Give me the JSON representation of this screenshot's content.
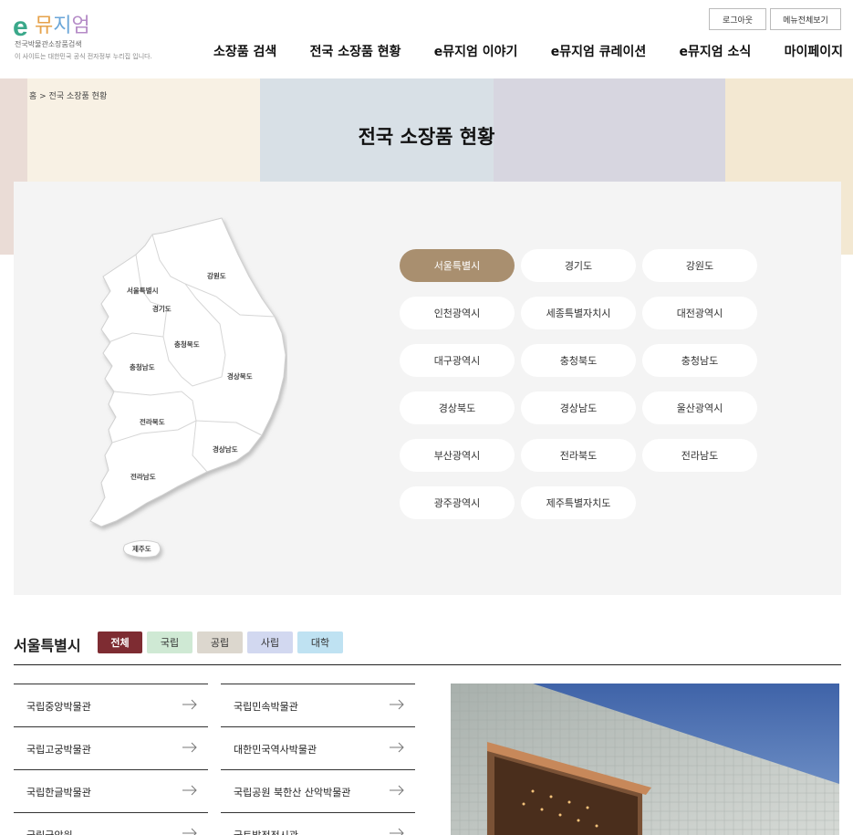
{
  "logo": {
    "mark": "e",
    "word": [
      "뮤",
      "지",
      "엄"
    ],
    "subtitle": "전국박물관소장품검색",
    "note": "이 사이트는 대한민국 공식 전자정부 누리집 입니다."
  },
  "util": {
    "logout": "로그아웃",
    "all_menu": "메뉴전체보기"
  },
  "gnb": [
    "소장품 검색",
    "전국 소장품 현황",
    "e뮤지엄 이야기",
    "e뮤지엄 큐레이션",
    "e뮤지엄 소식",
    "마이페이지"
  ],
  "breadcrumb": "홈 > 전국 소장품 현황",
  "page_title": "전국 소장품 현황",
  "map_labels": {
    "seoul": "서울특별시",
    "gyeonggi": "경기도",
    "gangwon": "강원도",
    "chungbuk": "충청북도",
    "chungnam": "충청남도",
    "gyeongbuk": "경상북도",
    "jeonbuk": "전라북도",
    "gyeongnam": "경상남도",
    "jeonnam": "전라남도",
    "jeju": "제주도"
  },
  "regions": [
    "서울특별시",
    "경기도",
    "강원도",
    "인천광역시",
    "세종특별자치시",
    "대전광역시",
    "대구광역시",
    "충청북도",
    "충청남도",
    "경상북도",
    "경상남도",
    "울산광역시",
    "부산광역시",
    "전라북도",
    "전라남도",
    "광주광역시",
    "제주특별자치도"
  ],
  "active_region": "서울특별시",
  "section": {
    "title": "서울특별시",
    "filters": [
      "전체",
      "국립",
      "공립",
      "사립",
      "대학"
    ]
  },
  "museums": [
    "국립중앙박물관",
    "국립민속박물관",
    "국립고궁박물관",
    "대한민국역사박물관",
    "국립한글박물관",
    "국립공원 북한산 산악박물관",
    "국립극악원",
    "국토발전전시관"
  ],
  "colors": {
    "active_region": "#a98f6f",
    "filter_all": "#7e2c32",
    "filter_national": "#cfe9d4",
    "filter_public": "#dcd7ce",
    "filter_private": "#d2d8f0",
    "filter_university": "#bfe2f2"
  }
}
